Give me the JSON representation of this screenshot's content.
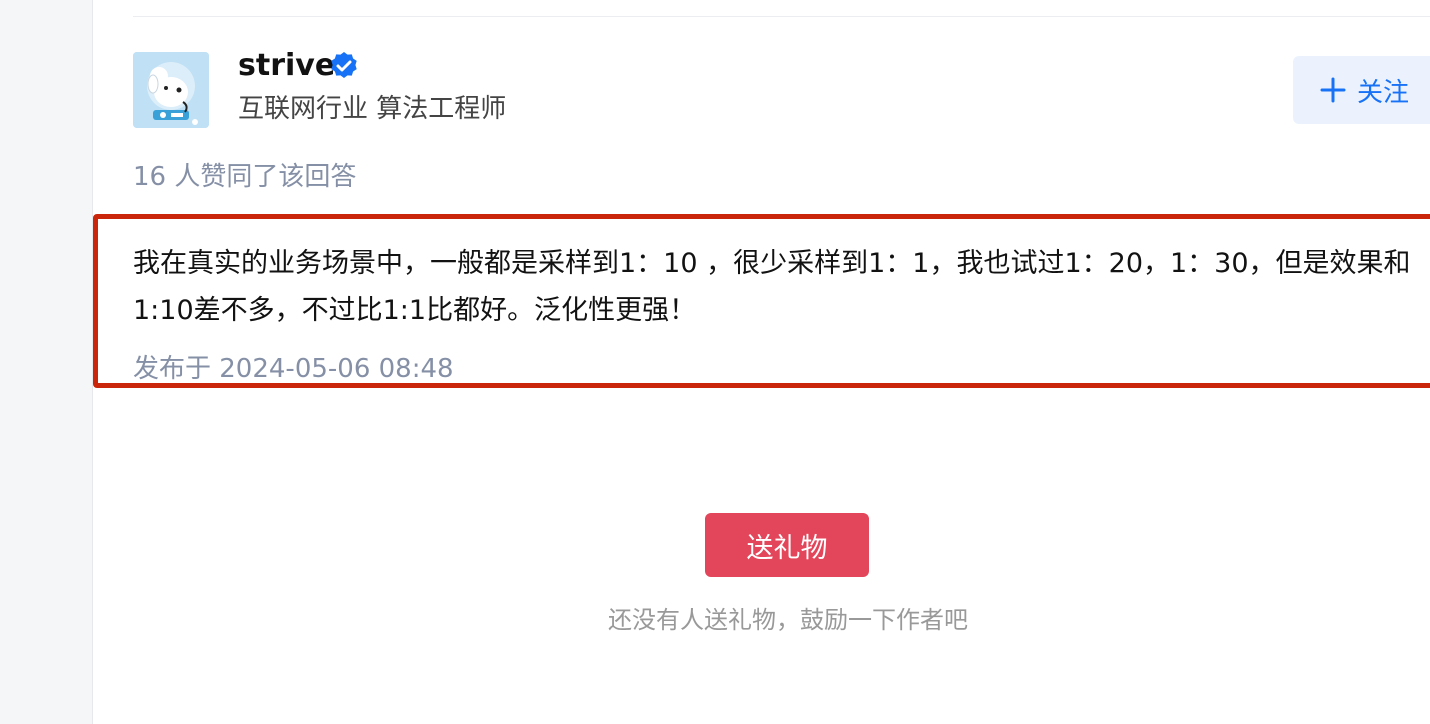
{
  "author": {
    "name": "strive",
    "headline": "互联网行业 算法工程师",
    "avatar_icon": "cartoon-dog-avatar",
    "verified_icon": "verified-badge-icon"
  },
  "follow_button": {
    "label": "关注",
    "icon": "plus-icon"
  },
  "likes_info": "16 人赞同了该回答",
  "answer": {
    "text": "我在真实的业务场景中，一般都是采样到1：10 ，很少采样到1：1，我也试过1：20，1：30，但是效果和1:10差不多，不过比1:1比都好。泛化性更强！",
    "publish_time": "发布于 2024-05-06 08:48"
  },
  "gift": {
    "button_label": "送礼物",
    "hint": "还没有人送礼物，鼓励一下作者吧"
  },
  "colors": {
    "accent_blue": "#1772f6",
    "highlight_red": "#c9260c",
    "gift_red": "#e3455a",
    "meta_gray": "#8590a6"
  }
}
